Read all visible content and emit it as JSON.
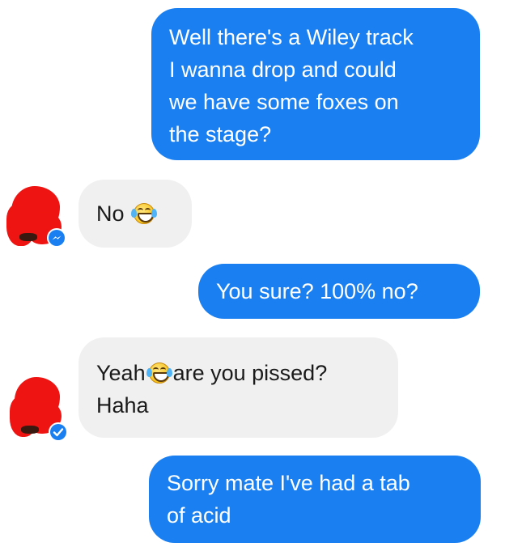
{
  "thread": {
    "messages": [
      {
        "id": "msg1",
        "direction": "outgoing",
        "lines": [
          "Well there's a Wiley track",
          "I wanna drop and could",
          "we have some foxes on",
          "the stage?"
        ]
      },
      {
        "id": "msg2",
        "direction": "incoming",
        "text": "No",
        "emoji": "face-with-tears-of-joy-icon"
      },
      {
        "id": "msg3",
        "direction": "outgoing",
        "text": "You sure? 100% no?"
      },
      {
        "id": "msg4",
        "direction": "incoming",
        "line1_before": "Yeah",
        "emoji": "face-with-tears-of-joy-icon",
        "line1_after": "are you pissed?",
        "line2": "Haha"
      },
      {
        "id": "msg5",
        "direction": "outgoing",
        "lines": [
          "Sorry mate I've had a tab",
          "of acid"
        ]
      }
    ]
  },
  "colors": {
    "outgoing_bubble": "#1a80f2",
    "incoming_bubble": "#f1f0f0",
    "redaction": "#ee1411",
    "messenger_badge": "#1a80f2"
  }
}
